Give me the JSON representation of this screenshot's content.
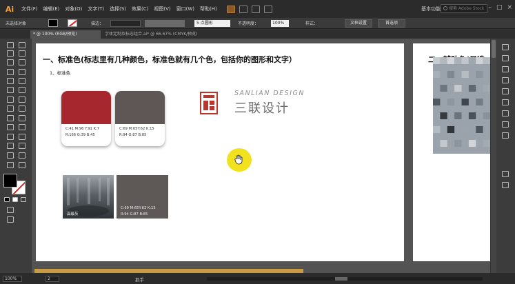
{
  "app": {
    "logo": "Ai"
  },
  "menu": [
    "文件(F)",
    "编辑(E)",
    "对象(O)",
    "文字(T)",
    "选择(S)",
    "效果(C)",
    "视图(V)",
    "窗口(W)",
    "帮助(H)"
  ],
  "top_right": {
    "workspace": "基本功能",
    "search_placeholder": "搜索 Adobe Stock"
  },
  "controlbar": {
    "no_selection": "未选择对象",
    "stroke_label": "描边：",
    "brush_label": "5 点圆形",
    "opacity_label": "不透明度：",
    "opacity_value": "100%",
    "style_label": "样式：",
    "doc_setup": "文档设置",
    "preferences": "首选项"
  },
  "tabs": {
    "active": "* @ 100% (RGB/预览)",
    "inactive": "字体定制及标志组合.ai* @ 66.67% (CMYK/预览)"
  },
  "artboard1": {
    "heading": "一、标准色(标志里有几种颜色，标准色就有几个色，包括你的图形和文字）",
    "subheading": "1、标准色",
    "card_red": {
      "line1": "C:41 M:96 Y:91 K:7",
      "line2": "R:166 G:39 B:45",
      "color": "#a6272d"
    },
    "card_gray": {
      "line1": "C:69 M:65Y:62 K:15",
      "line2": "R:94 G:87 B:85",
      "color": "#5e5755"
    },
    "logo": {
      "en": "SANLIAN DESIGN",
      "cn": "三联设计"
    },
    "photo_label": "高级灰",
    "dark_block": {
      "line1": "C:69 M:65Y:62 K:15",
      "line2": "R:94 G:87 B:85"
    }
  },
  "artboard2": {
    "heading": "二、辅助色(只选"
  },
  "statusbar": {
    "zoom": "100%",
    "page": "2",
    "tool": "抓手"
  },
  "colors": {
    "accent_orange": "#f7a43c",
    "cursor_yellow": "#f2e11e",
    "brand_red": "#b9372f"
  }
}
